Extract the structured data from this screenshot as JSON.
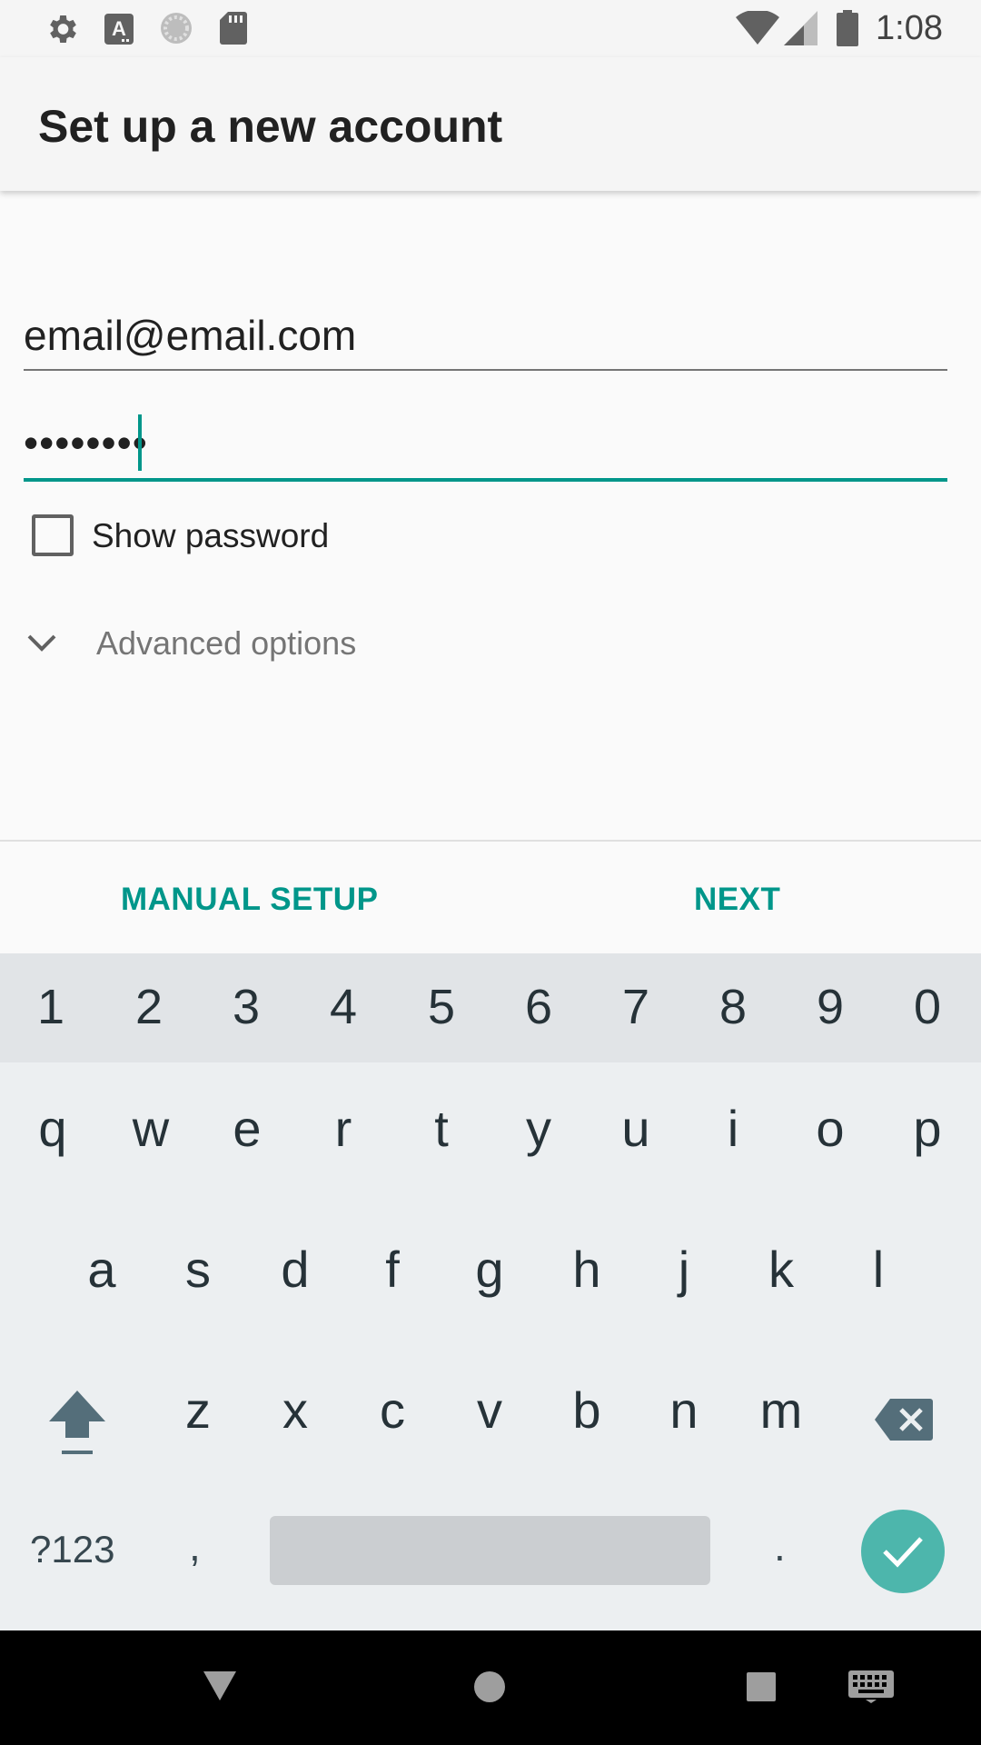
{
  "status_bar": {
    "time": "1:08",
    "left_icons": [
      "gear-icon",
      "keyboard-a-icon",
      "sync-circle-icon",
      "sd-card-icon"
    ],
    "right_icons": [
      "wifi-icon",
      "cell-signal-icon",
      "battery-icon"
    ]
  },
  "app_bar": {
    "title": "Set up a new account"
  },
  "form": {
    "email_value": "email@email.com",
    "password_value": "••••••••",
    "show_password_label": "Show password",
    "show_password_checked": false,
    "advanced_options_label": "Advanced options"
  },
  "buttons": {
    "manual_setup": "MANUAL SETUP",
    "next": "NEXT"
  },
  "keyboard": {
    "number_row": [
      "1",
      "2",
      "3",
      "4",
      "5",
      "6",
      "7",
      "8",
      "9",
      "0"
    ],
    "row1": [
      "q",
      "w",
      "e",
      "r",
      "t",
      "y",
      "u",
      "i",
      "o",
      "p"
    ],
    "row2": [
      "a",
      "s",
      "d",
      "f",
      "g",
      "h",
      "j",
      "k",
      "l"
    ],
    "row3": [
      "z",
      "x",
      "c",
      "v",
      "b",
      "n",
      "m"
    ],
    "symbols_key": "?123",
    "comma_key": ",",
    "period_key": "."
  },
  "colors": {
    "accent": "#00968a",
    "enter_key": "#4db6ac"
  }
}
